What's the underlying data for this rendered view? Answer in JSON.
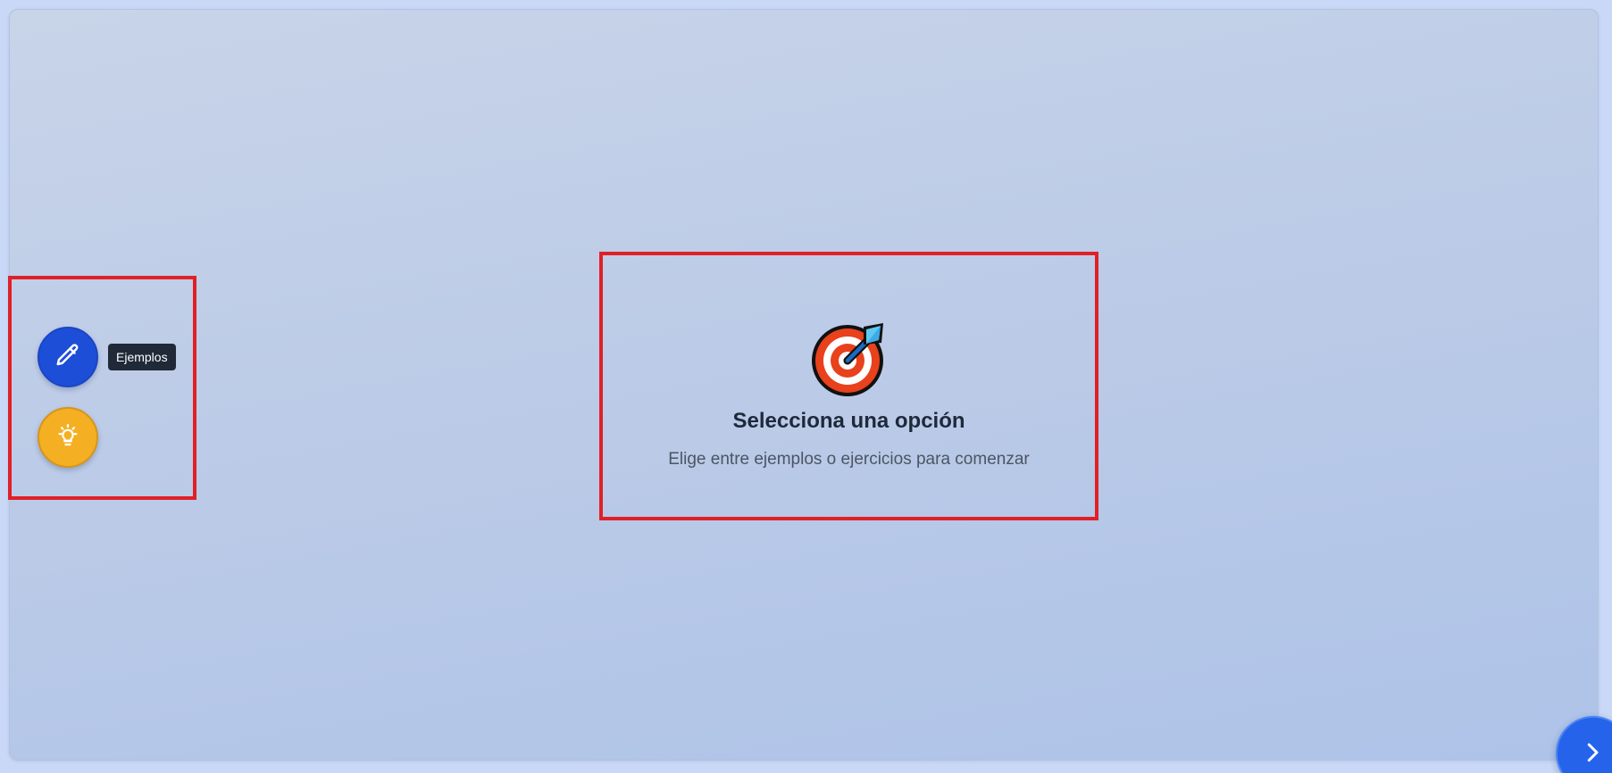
{
  "floating_menu": {
    "examples_button": {
      "icon": "pencil-icon",
      "color": "#1d4ed8"
    },
    "exercises_button": {
      "icon": "lightbulb-icon",
      "color": "#f4b022"
    },
    "tooltip": "Ejemplos"
  },
  "empty_state": {
    "icon": "target-icon",
    "title": "Selecciona una opción",
    "subtitle": "Elige entre ejemplos o ejercicios para comenzar"
  },
  "navigation": {
    "next_button": {
      "icon": "chevron-right-icon",
      "color": "#2563eb"
    }
  },
  "highlight_color": "#e02027"
}
